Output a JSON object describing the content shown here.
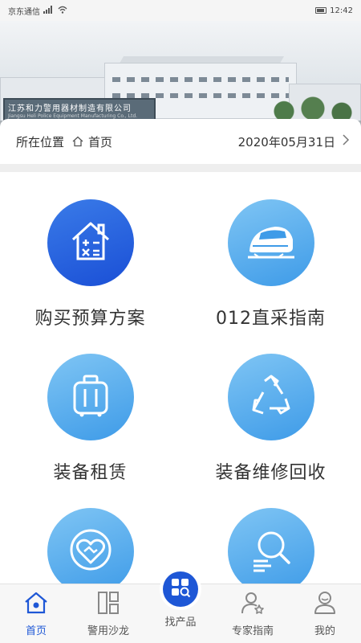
{
  "status_bar": {
    "carrier": "京东通信",
    "time": "12:42"
  },
  "banner": {
    "sign_text": "江苏和力警用器材制造有限公司",
    "sign_subtext": "Jiangsu Heli Police Equipment Manufacturing Co., Ltd."
  },
  "location": {
    "label": "所在位置",
    "current": "首页",
    "date": "2020年05月31日"
  },
  "tiles": [
    {
      "label": "购买预算方案",
      "icon": "budget-house-icon"
    },
    {
      "label": "012直采指南",
      "icon": "bullet-train-icon"
    },
    {
      "label": "装备租赁",
      "icon": "luggage-icon"
    },
    {
      "label": "装备维修回收",
      "icon": "recycle-icon"
    },
    {
      "label": "",
      "icon": "handshake-heart-icon"
    },
    {
      "label": "",
      "icon": "search-list-icon"
    }
  ],
  "tabbar": {
    "items": [
      {
        "label": "首页",
        "icon": "home-icon",
        "active": true
      },
      {
        "label": "警用沙龙",
        "icon": "layout-icon"
      },
      {
        "label": "找产品",
        "icon": "find-product-icon"
      },
      {
        "label": "专家指南",
        "icon": "expert-icon"
      },
      {
        "label": "我的",
        "icon": "profile-icon"
      }
    ]
  },
  "colors": {
    "primary": "#1e57d6",
    "tile_deep": "#1a4fd6",
    "tile_light": "#4ea7ec"
  }
}
